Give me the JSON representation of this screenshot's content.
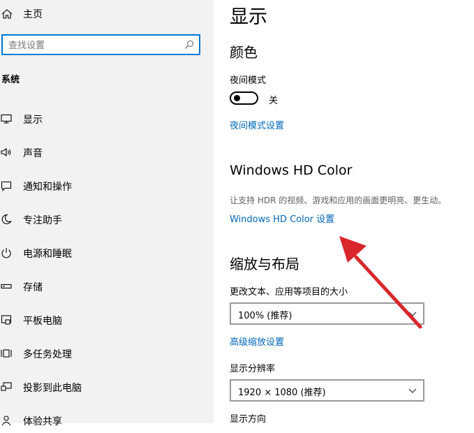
{
  "sidebar": {
    "home_label": "主页",
    "search_placeholder": "查找设置",
    "section_title": "系统",
    "items": [
      {
        "label": "显示",
        "icon": "monitor-icon"
      },
      {
        "label": "声音",
        "icon": "speaker-icon"
      },
      {
        "label": "通知和操作",
        "icon": "notification-icon"
      },
      {
        "label": "专注助手",
        "icon": "moon-icon"
      },
      {
        "label": "电源和睡眠",
        "icon": "power-icon"
      },
      {
        "label": "存储",
        "icon": "storage-icon"
      },
      {
        "label": "平板电脑",
        "icon": "tablet-icon"
      },
      {
        "label": "多任务处理",
        "icon": "multitask-icon"
      },
      {
        "label": "投影到此电脑",
        "icon": "project-icon"
      },
      {
        "label": "体验共享",
        "icon": "share-icon"
      }
    ]
  },
  "main": {
    "title": "显示",
    "color": {
      "heading": "颜色",
      "night_mode_label": "夜间模式",
      "night_mode_state": "关",
      "night_mode_on": false,
      "night_mode_link": "夜间模式设置"
    },
    "hdr": {
      "heading": "Windows HD Color",
      "description": "让支持 HDR 的视频、游戏和应用的画面更明亮、更生动。",
      "link": "Windows HD Color 设置"
    },
    "scale": {
      "heading": "缩放与布局",
      "size_label": "更改文本、应用等项目的大小",
      "size_value": "100% (推荐)",
      "advanced_link": "高级缩放设置",
      "resolution_label": "显示分辨率",
      "resolution_value": "1920 × 1080 (推荐)",
      "orientation_label": "显示方向"
    }
  },
  "colors": {
    "accent": "#0078d7",
    "link": "#0067b8",
    "sidebar_bg": "#f2f2f2",
    "annotation_arrow": "#d9262c"
  }
}
